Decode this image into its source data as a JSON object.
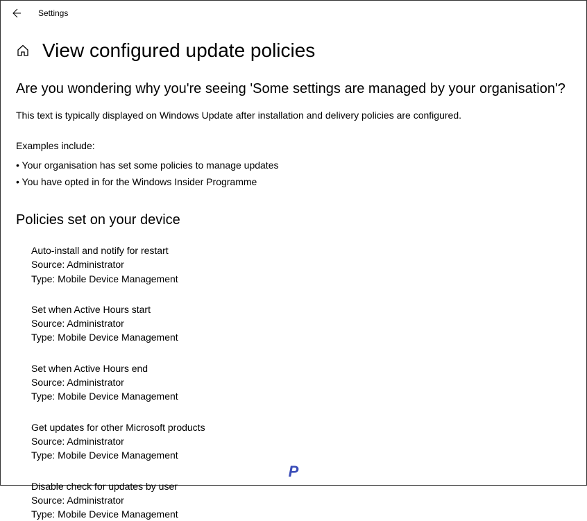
{
  "titlebar": {
    "app_title": "Settings"
  },
  "header": {
    "title": "View configured update policies"
  },
  "intro": {
    "question": "Are you wondering why you're seeing 'Some settings are managed by your organisation'?",
    "description": "This text is typically displayed on Windows Update after installation and delivery policies are configured.",
    "examples_label": "Examples include:",
    "examples": [
      "Your organisation has set some policies to manage updates",
      "You have opted in for the Windows Insider Programme"
    ]
  },
  "policies_section": {
    "heading": "Policies set on your device",
    "policies": [
      {
        "name": "Auto-install and notify for restart",
        "source_label": "Source: ",
        "source_value": "Administrator",
        "type_label": "Type: ",
        "type_value": "Mobile Device Management"
      },
      {
        "name": "Set when Active Hours start",
        "source_label": "Source: ",
        "source_value": "Administrator",
        "type_label": "Type: ",
        "type_value": "Mobile Device Management"
      },
      {
        "name": "Set when Active Hours end",
        "source_label": "Source: ",
        "source_value": "Administrator",
        "type_label": "Type: ",
        "type_value": "Mobile Device Management"
      },
      {
        "name": "Get updates for other Microsoft products",
        "source_label": "Source: ",
        "source_value": "Administrator",
        "type_label": "Type: ",
        "type_value": "Mobile Device Management"
      },
      {
        "name": "Disable check for updates by user",
        "source_label": "Source: ",
        "source_value": "Administrator",
        "type_label": "Type: ",
        "type_value": "Mobile Device Management"
      }
    ]
  },
  "watermark": "P"
}
